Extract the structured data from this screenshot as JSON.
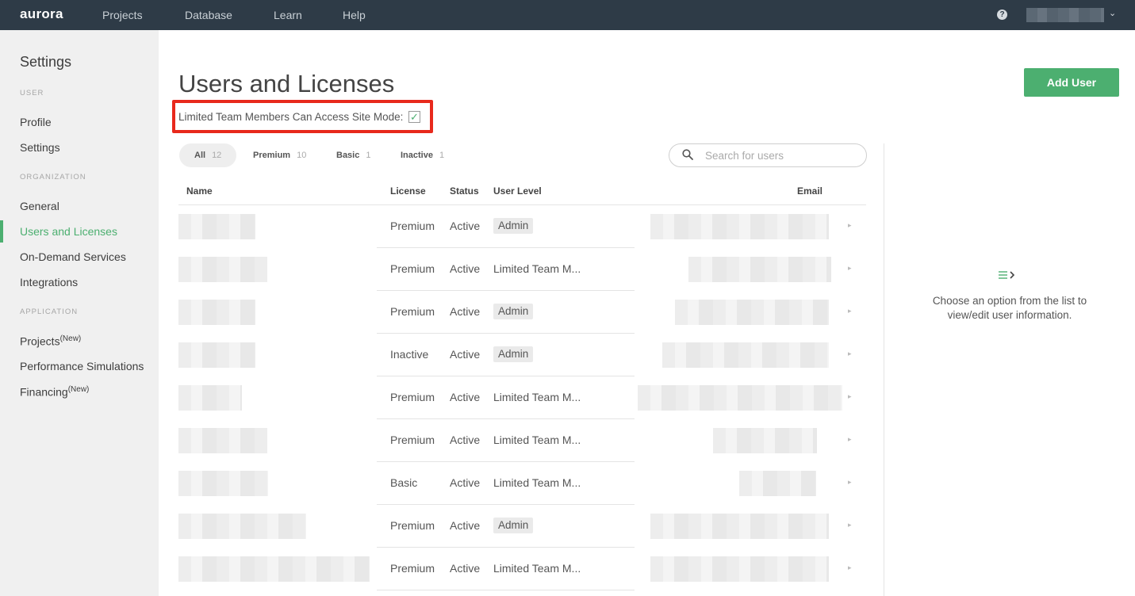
{
  "app": {
    "logo": "aurora"
  },
  "topnav": {
    "items": [
      "Projects",
      "Database",
      "Learn",
      "Help"
    ],
    "help_icon": "question-circle-icon"
  },
  "sidebar": {
    "title": "Settings",
    "sections": {
      "user": "USER",
      "organization": "ORGANIZATION",
      "application": "APPLICATION"
    },
    "items": {
      "profile": "Profile",
      "settings": "Settings",
      "general": "General",
      "users_licenses": "Users and Licenses",
      "on_demand": "On-Demand Services",
      "integrations": "Integrations",
      "projects": "Projects",
      "projects_tag": "(New)",
      "performance": "Performance Simulations",
      "financing": "Financing",
      "financing_tag": "(New)"
    },
    "active": "Users and Licenses"
  },
  "main": {
    "title": "Users and Licenses",
    "add_user_label": "Add User",
    "site_mode_label": "Limited Team Members Can Access Site Mode:",
    "site_mode_checked": true,
    "filters": [
      {
        "label": "All",
        "count": "12"
      },
      {
        "label": "Premium",
        "count": "10"
      },
      {
        "label": "Basic",
        "count": "1"
      },
      {
        "label": "Inactive",
        "count": "1"
      }
    ],
    "search": {
      "placeholder": "Search for users"
    },
    "table": {
      "columns": [
        "Name",
        "License",
        "Status",
        "User Level",
        "Email"
      ],
      "rows": [
        {
          "license": "Premium",
          "status": "Active",
          "level": "Admin",
          "is_badge": true
        },
        {
          "license": "Premium",
          "status": "Active",
          "level": "Limited Team M...",
          "is_badge": false
        },
        {
          "license": "Premium",
          "status": "Active",
          "level": "Admin",
          "is_badge": true
        },
        {
          "license": "Inactive",
          "status": "Active",
          "level": "Admin",
          "is_badge": true
        },
        {
          "license": "Premium",
          "status": "Active",
          "level": "Limited Team M...",
          "is_badge": false
        },
        {
          "license": "Premium",
          "status": "Active",
          "level": "Limited Team M...",
          "is_badge": false
        },
        {
          "license": "Basic",
          "status": "Active",
          "level": "Limited Team M...",
          "is_badge": false
        },
        {
          "license": "Premium",
          "status": "Active",
          "level": "Admin",
          "is_badge": true
        },
        {
          "license": "Premium",
          "status": "Active",
          "level": "Limited Team M...",
          "is_badge": false
        }
      ]
    }
  },
  "right_panel": {
    "icon": "list-arrow-icon",
    "message": "Choose an option from the list to view/edit user information."
  },
  "colors": {
    "accent": "#4caf70",
    "topbar": "#2e3b47",
    "highlight": "#e8291c"
  }
}
